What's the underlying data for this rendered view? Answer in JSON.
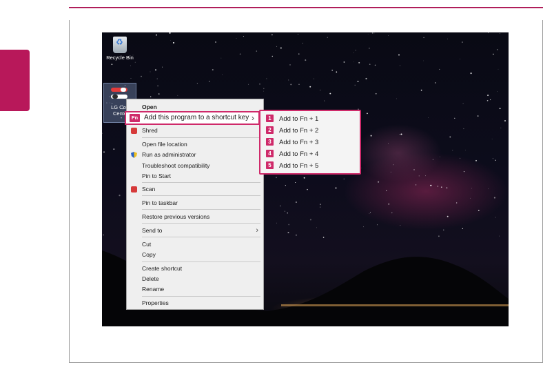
{
  "desktop": {
    "icons": [
      {
        "name": "Recycle Bin"
      },
      {
        "name_line1": "LG Con",
        "name_line2": "Cente"
      }
    ]
  },
  "context_menu": {
    "open": "Open",
    "add_shortcut": {
      "badge": "Fn",
      "label": "Add this program to a shortcut key"
    },
    "shred": "Shred",
    "open_file_location": "Open file location",
    "run_as_admin": "Run as administrator",
    "troubleshoot": "Troubleshoot compatibility",
    "pin_to_start": "Pin to Start",
    "scan": "Scan",
    "pin_to_taskbar": "Pin to taskbar",
    "restore_versions": "Restore previous versions",
    "send_to": "Send to",
    "cut": "Cut",
    "copy": "Copy",
    "create_shortcut": "Create shortcut",
    "delete": "Delete",
    "rename": "Rename",
    "properties": "Properties"
  },
  "submenu": [
    {
      "num": "1",
      "label": "Add to Fn + 1"
    },
    {
      "num": "2",
      "label": "Add to Fn + 2"
    },
    {
      "num": "3",
      "label": "Add to Fn + 3"
    },
    {
      "num": "4",
      "label": "Add to Fn + 4"
    },
    {
      "num": "5",
      "label": "Add to Fn + 5"
    }
  ],
  "colors": {
    "accent": "#cf2a6a",
    "menu_bg": "#efefef"
  }
}
